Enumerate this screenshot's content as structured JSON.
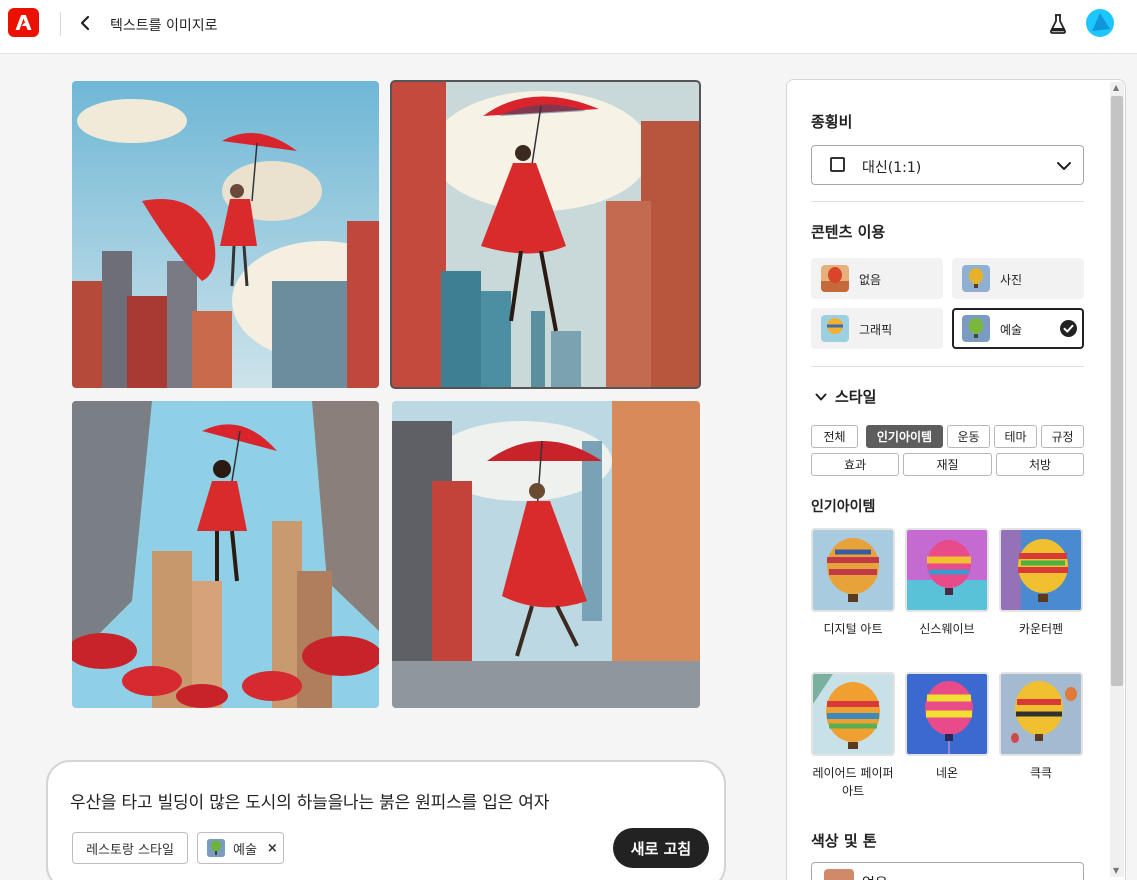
{
  "header": {
    "title": "텍스트를 이미지로"
  },
  "prompt": {
    "text": "우산을 타고 빌딩이 많은 도시의 하늘을나는 붉은 원피스를 입은 여자",
    "chips": {
      "style": "레스토랑 스타일",
      "content": "예술"
    },
    "refresh_label": "새로 고침"
  },
  "panel": {
    "aspect_ratio": {
      "title": "종횡비",
      "value": "대신(1:1)"
    },
    "content_type": {
      "title": "콘텐츠 이용",
      "options": [
        "없음",
        "사진",
        "그래픽",
        "예술"
      ],
      "selected": "예술"
    },
    "styles": {
      "title": "스타일",
      "tags": [
        "전체",
        "인기아이템",
        "운동",
        "테마",
        "규정",
        "효과",
        "재질",
        "처방"
      ],
      "active_tag": "인기아이템",
      "section_title": "인기아이템",
      "items": [
        "디지털 아트",
        "신스웨이브",
        "카운터펜",
        "레이어드 페이퍼",
        "아트",
        "네온",
        "큭큭"
      ]
    },
    "color_tone": {
      "title": "색상 및 톤",
      "value": "없음"
    }
  },
  "colors": {
    "brand": "#eb1000",
    "accent_dark": "#222222",
    "avatar": "#1ec6ff"
  }
}
